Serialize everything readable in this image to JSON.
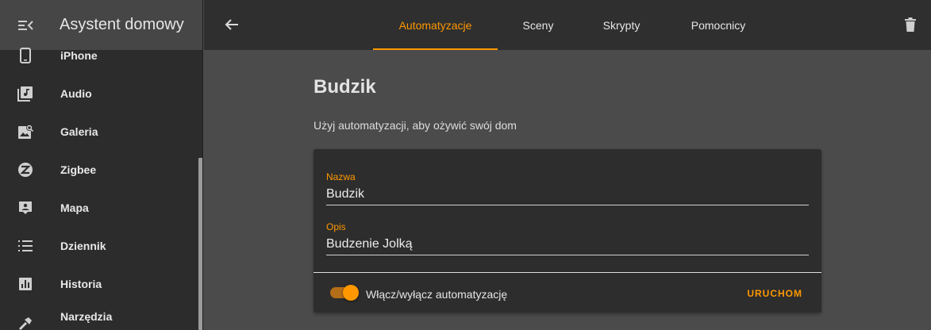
{
  "sidebar": {
    "title": "Asystent domowy",
    "items": [
      {
        "label": "iPhone",
        "icon": "phone-icon"
      },
      {
        "label": "Audio",
        "icon": "library-music-icon"
      },
      {
        "label": "Galeria",
        "icon": "image-search-icon"
      },
      {
        "label": "Zigbee",
        "icon": "zigbee-icon"
      },
      {
        "label": "Mapa",
        "icon": "map-account-icon"
      },
      {
        "label": "Dziennik",
        "icon": "list-icon"
      },
      {
        "label": "Historia",
        "icon": "chart-bar-icon"
      },
      {
        "label": "Narzędzia",
        "icon": "hammer-icon"
      }
    ]
  },
  "tabs": [
    {
      "label": "Automatyzacje",
      "active": true
    },
    {
      "label": "Sceny",
      "active": false
    },
    {
      "label": "Skrypty",
      "active": false
    },
    {
      "label": "Pomocnicy",
      "active": false
    }
  ],
  "main": {
    "heading": "Budzik",
    "description": "Użyj automatyzacji, aby ożywić swój dom"
  },
  "form": {
    "name_label": "Nazwa",
    "name_value": "Budzik",
    "desc_label": "Opis",
    "desc_value": "Budzenie Jolką",
    "toggle_label": "Włącz/wyłącz automatyzację",
    "toggle_on": true,
    "run_label": "URUCHOM"
  },
  "colors": {
    "accent": "#ff9800",
    "sidebar_bg": "#2c2c2c",
    "topbar_bg": "#2f2f2f",
    "page_bg": "#4b4b4b",
    "card_bg": "#2d2d2d"
  }
}
